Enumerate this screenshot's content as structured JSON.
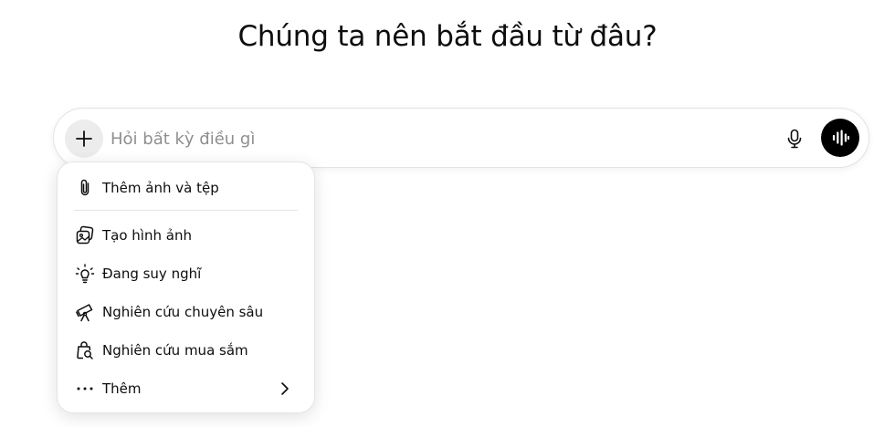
{
  "heading": "Chúng ta nên bắt đầu từ đâu?",
  "composer": {
    "placeholder": "Hỏi bất kỳ điều gì",
    "icons": {
      "add": "plus-icon",
      "mic": "microphone-icon",
      "voice": "voice-waveform-icon"
    }
  },
  "menu": {
    "items": [
      {
        "label": "Thêm ảnh và tệp",
        "icon": "paperclip-icon"
      },
      {
        "label": "Tạo hình ảnh",
        "icon": "image-create-icon"
      },
      {
        "label": "Đang suy nghĩ",
        "icon": "lightbulb-icon"
      },
      {
        "label": "Nghiên cứu chuyên sâu",
        "icon": "telescope-icon"
      },
      {
        "label": "Nghiên cứu mua sắm",
        "icon": "shopping-bag-search-icon"
      },
      {
        "label": "Thêm",
        "icon": "more-dots-icon",
        "submenu_icon": "chevron-right-icon"
      }
    ]
  },
  "colors": {
    "accent": "#000000",
    "plus_button_bg": "#ececec",
    "placeholder": "#8f8f8f",
    "border": "#e3e3e3"
  }
}
